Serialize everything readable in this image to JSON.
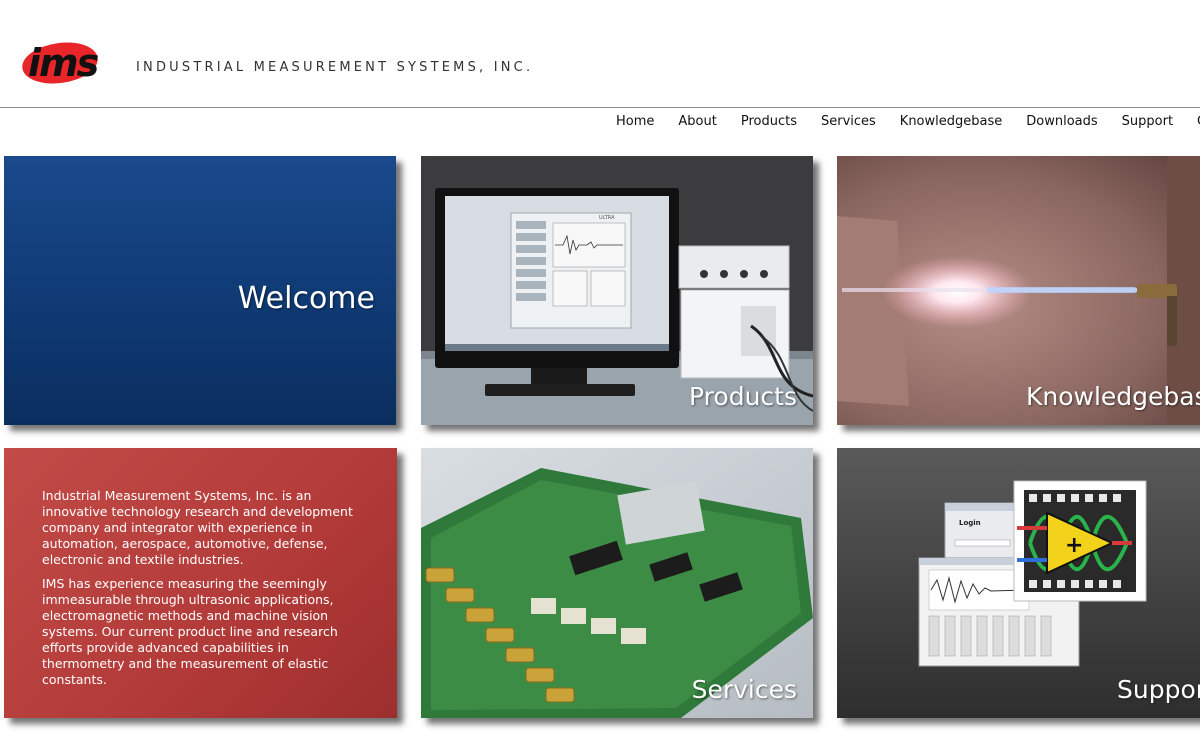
{
  "header": {
    "logo_text": "ims",
    "company_name": "INDUSTRIAL MEASUREMENT SYSTEMS, INC.",
    "logo_color": "#e8262a"
  },
  "nav": {
    "items": [
      "Home",
      "About",
      "Products",
      "Services",
      "Knowledgebase",
      "Downloads",
      "Support",
      "Co"
    ]
  },
  "tiles": {
    "welcome": {
      "label": "Welcome"
    },
    "products": {
      "label": "Products"
    },
    "knowledgebase": {
      "label": "Knowledgebase"
    },
    "services": {
      "label": "Services"
    },
    "support": {
      "label": "Support"
    }
  },
  "about": {
    "paragraph1": "Industrial Measurement Systems, Inc. is an innovative technology research and development company and integrator with experience in automation, aerospace, automotive, defense, electronic and textile industries.",
    "paragraph2": "IMS has experience measuring the seemingly immeasurable through ultrasonic applications, electromagnetic methods and machine vision systems.  Our current product line and research efforts provide advanced capabilities in thermometry and the measurement of elastic constants."
  },
  "support_illustration": {
    "login_title": "Login",
    "monitor_label": "ULTRA"
  }
}
